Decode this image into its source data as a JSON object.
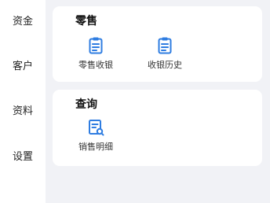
{
  "sidebar": {
    "items": [
      {
        "label": "资金"
      },
      {
        "label": "客户"
      },
      {
        "label": "资料"
      },
      {
        "label": "设置"
      }
    ]
  },
  "retail": {
    "title": "零售",
    "tiles": [
      {
        "label": "零售收银",
        "icon": "clipboard-list-icon"
      },
      {
        "label": "收银历史",
        "icon": "clipboard-list-icon"
      }
    ]
  },
  "query": {
    "title": "查询",
    "tiles": [
      {
        "label": "销售明细",
        "icon": "document-search-icon"
      }
    ]
  },
  "colors": {
    "accent": "#2f7de1",
    "background": "#f1f2f6",
    "card": "#ffffff"
  }
}
